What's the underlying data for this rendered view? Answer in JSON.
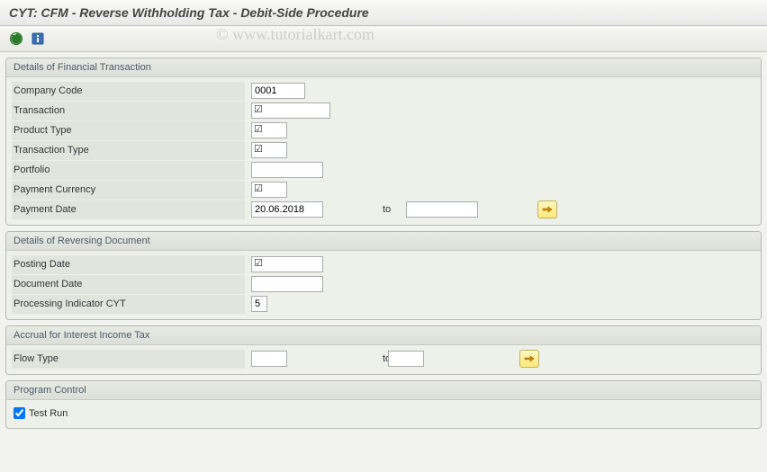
{
  "title": "CYT: CFM - Reverse Withholding Tax - Debit-Side Procedure",
  "watermark": "© www.tutorialkart.com",
  "toolbar": {
    "execute": "Execute",
    "info": "Information"
  },
  "groups": {
    "fin": {
      "title": "Details of Financial Transaction",
      "company_code_lbl": "Company Code",
      "company_code_val": "0001",
      "transaction_lbl": "Transaction",
      "transaction_val": "",
      "product_type_lbl": "Product Type",
      "product_type_val": "",
      "transaction_type_lbl": "Transaction Type",
      "transaction_type_val": "",
      "portfolio_lbl": "Portfolio",
      "portfolio_val": "",
      "payment_currency_lbl": "Payment Currency",
      "payment_currency_val": "",
      "payment_date_lbl": "Payment Date",
      "payment_date_from": "20.06.2018",
      "to_lbl": "to",
      "payment_date_to": ""
    },
    "rev": {
      "title": "Details of Reversing Document",
      "posting_date_lbl": "Posting Date",
      "posting_date_val": "",
      "document_date_lbl": "Document Date",
      "document_date_val": "",
      "proc_ind_lbl": "Processing Indicator CYT",
      "proc_ind_val": "5"
    },
    "acc": {
      "title": "Accrual for Interest Income Tax",
      "flow_type_lbl": "Flow Type",
      "flow_type_from": "",
      "to_lbl": "to",
      "flow_type_to": ""
    },
    "prog": {
      "title": "Program Control",
      "test_run_lbl": "Test Run",
      "test_run_checked": true
    }
  },
  "icons": {
    "required_mark": "☑",
    "multi_arrow": "⇨"
  }
}
